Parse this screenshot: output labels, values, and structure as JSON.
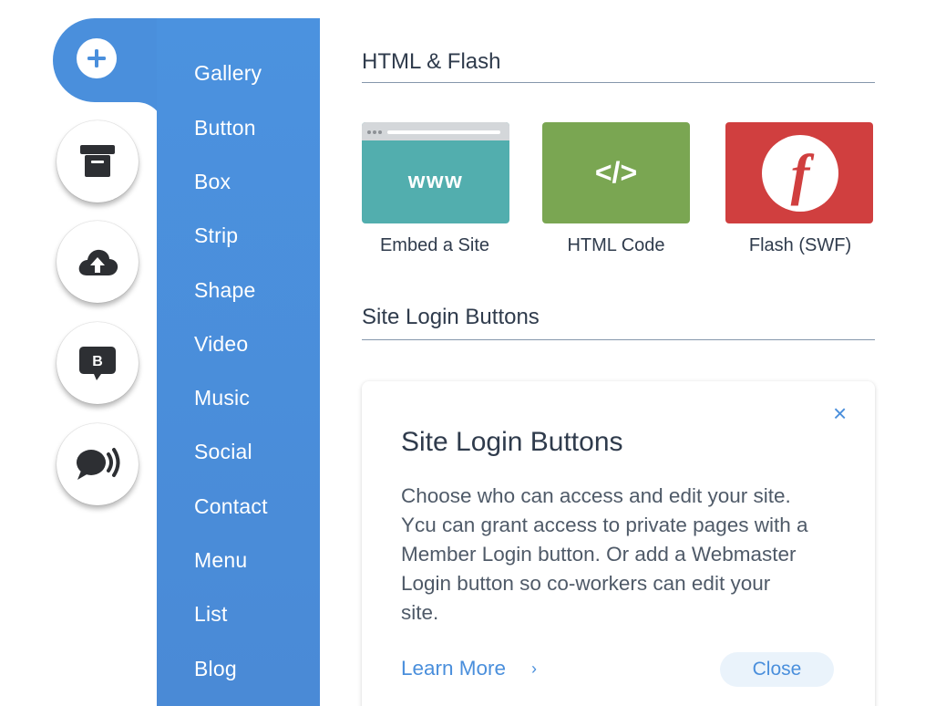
{
  "rail": {
    "buttons": [
      {
        "icon": "add-icon"
      },
      {
        "icon": "store-icon"
      },
      {
        "icon": "cloud-upload-icon"
      },
      {
        "icon": "blog-chat-icon",
        "glyph": "B"
      },
      {
        "icon": "chat-sound-icon"
      }
    ],
    "accent": "#4a8fdc"
  },
  "menu": {
    "items": [
      "Gallery",
      "Button",
      "Box",
      "Strip",
      "Shape",
      "Video",
      "Music",
      "Social",
      "Contact",
      "Menu",
      "List",
      "Blog"
    ]
  },
  "html_flash": {
    "title": "HTML & Flash",
    "tiles": [
      {
        "label": "Embed a Site",
        "glyph": "www",
        "color": "#52aeae"
      },
      {
        "label": "HTML Code",
        "glyph": "</>",
        "color": "#7aa652"
      },
      {
        "label": "Flash (SWF)",
        "glyph": "f",
        "color": "#d03f3f"
      }
    ]
  },
  "site_login": {
    "title": "Site Login Buttons",
    "card": {
      "title": "Site Login Buttons",
      "body": "Choose who can access and edit your site. Ycu can grant access to private pages with a Member Login button. Or add a Webmaster Login button so co-workers can edit your site.",
      "learn_more": "Learn More",
      "learn_more_chevron": "›",
      "close_label": "Close",
      "close_x": "×"
    }
  }
}
